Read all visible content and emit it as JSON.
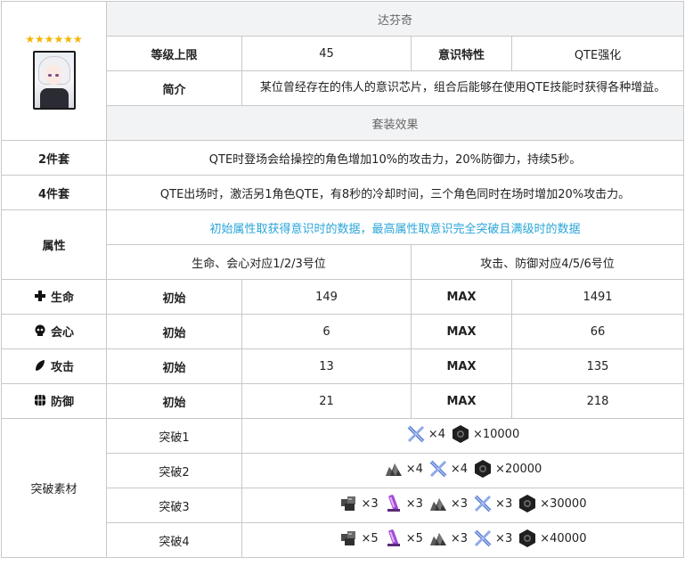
{
  "header": {
    "stars": "★★★★★★",
    "name": "达芬奇"
  },
  "info": {
    "level_cap_label": "等级上限",
    "level_cap_value": "45",
    "trait_label": "意识特性",
    "trait_value": "QTE强化",
    "intro_label": "简介",
    "intro_value": "某位曾经存在的伟人的意识芯片，组合后能够在使用QTE技能时获得各种增益。"
  },
  "set": {
    "title": "套装效果",
    "two_label": "2件套",
    "two_value": "QTE时登场会给操控的角色增加10%的攻击力，20%防御力，持续5秒。",
    "four_label": "4件套",
    "four_value": "QTE出场时，激活另1角色QTE，有8秒的冷却时间，三个角色同时在场时增加20%攻击力。"
  },
  "attributes": {
    "label": "属性",
    "note": "初始属性取获得意识时的数据，最高属性取意识完全突破且满级时的数据",
    "left_slots": "生命、会心对应1/2/3号位",
    "right_slots": "攻击、防御对应4/5/6号位",
    "init_label": "初始",
    "max_label": "MAX",
    "rows": [
      {
        "name": "生命",
        "icon": "cross-icon",
        "init": "149",
        "max": "1491"
      },
      {
        "name": "会心",
        "icon": "skull-icon",
        "init": "6",
        "max": "66"
      },
      {
        "name": "攻击",
        "icon": "feather-icon",
        "init": "13",
        "max": "135"
      },
      {
        "name": "防御",
        "icon": "shield-icon",
        "init": "21",
        "max": "218"
      }
    ]
  },
  "breakthrough": {
    "label": "突破素材",
    "rows": [
      {
        "name": "突破1",
        "items": [
          {
            "icon": "blue-crystal-icon",
            "qty": "×4"
          },
          {
            "icon": "gear-nut-icon",
            "qty": "×10000"
          }
        ]
      },
      {
        "name": "突破2",
        "items": [
          {
            "icon": "dark-ore-icon",
            "qty": "×4"
          },
          {
            "icon": "blue-crystal-icon",
            "qty": "×4"
          },
          {
            "icon": "gear-nut-icon",
            "qty": "×20000"
          }
        ]
      },
      {
        "name": "突破3",
        "items": [
          {
            "icon": "metal-chunk-icon",
            "qty": "×3"
          },
          {
            "icon": "purple-tube-icon",
            "qty": "×3"
          },
          {
            "icon": "dark-ore-icon",
            "qty": "×3"
          },
          {
            "icon": "blue-crystal-icon",
            "qty": "×3"
          },
          {
            "icon": "gear-nut-icon",
            "qty": "×30000"
          }
        ]
      },
      {
        "name": "突破4",
        "items": [
          {
            "icon": "metal-chunk-icon",
            "qty": "×5"
          },
          {
            "icon": "purple-tube-icon",
            "qty": "×5"
          },
          {
            "icon": "dark-ore-icon",
            "qty": "×3"
          },
          {
            "icon": "blue-crystal-icon",
            "qty": "×3"
          },
          {
            "icon": "gear-nut-icon",
            "qty": "×40000"
          }
        ]
      }
    ]
  }
}
